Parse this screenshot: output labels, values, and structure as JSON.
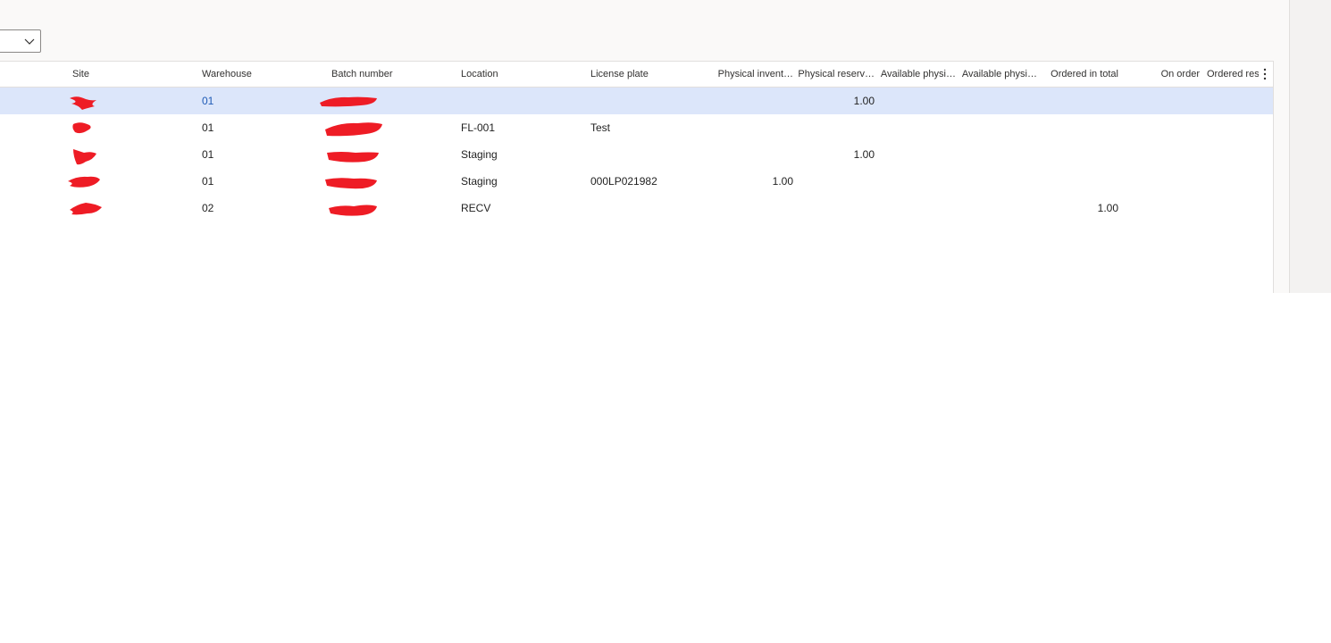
{
  "filter": {
    "value": ""
  },
  "grid": {
    "columns": {
      "site": "Site",
      "warehouse": "Warehouse",
      "batch": "Batch number",
      "location": "Location",
      "license_plate": "License plate",
      "physical_inventory": "Physical invent…",
      "physical_reserved": "Physical reserv…",
      "available_physical_1": "Available physi…",
      "available_physical_2": "Available physi…",
      "ordered_in_total": "Ordered in total",
      "on_order": "On order",
      "ordered_reserved": "Ordered res"
    },
    "rows": [
      {
        "warehouse": "01",
        "location": "",
        "license_plate": "",
        "physical_inventory": "",
        "physical_reserved": "1.00",
        "ordered_in_total": ""
      },
      {
        "warehouse": "01",
        "location": "FL-001",
        "license_plate": "Test",
        "physical_inventory": "",
        "physical_reserved": "",
        "ordered_in_total": ""
      },
      {
        "warehouse": "01",
        "location": "Staging",
        "license_plate": "",
        "physical_inventory": "",
        "physical_reserved": "1.00",
        "ordered_in_total": ""
      },
      {
        "warehouse": "01",
        "location": "Staging",
        "license_plate": "000LP021982",
        "physical_inventory": "1.00",
        "physical_reserved": "",
        "ordered_in_total": ""
      },
      {
        "warehouse": "02",
        "location": "RECV",
        "license_plate": "",
        "physical_inventory": "",
        "physical_reserved": "",
        "ordered_in_total": "1.00"
      }
    ]
  },
  "icons": {
    "dropdown": "chevron-down-icon",
    "more": "more-vertical-icon",
    "redaction": "redaction-mark"
  },
  "colors": {
    "selected_row": "#dce6fa",
    "link": "#1f5bb6",
    "redaction": "#ee1c25"
  }
}
